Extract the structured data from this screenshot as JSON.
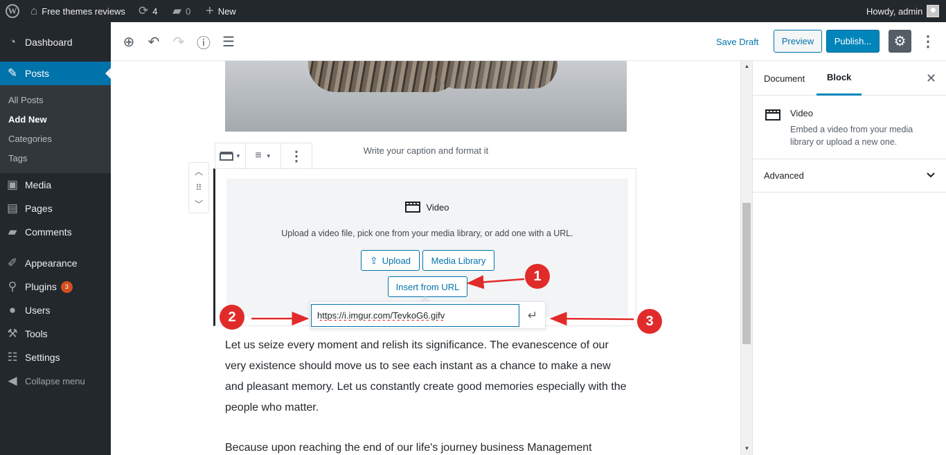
{
  "adminbar": {
    "site_name": "Free themes reviews",
    "updates_count": "4",
    "comments_count": "0",
    "new_label": "New",
    "greeting": "Howdy, admin"
  },
  "sidebar": {
    "dashboard": "Dashboard",
    "posts": "Posts",
    "sub_all_posts": "All Posts",
    "sub_add_new": "Add New",
    "sub_categories": "Categories",
    "sub_tags": "Tags",
    "media": "Media",
    "pages": "Pages",
    "comments": "Comments",
    "appearance": "Appearance",
    "plugins": "Plugins",
    "plugins_badge": "3",
    "users": "Users",
    "tools": "Tools",
    "settings": "Settings",
    "collapse": "Collapse menu"
  },
  "header": {
    "save_draft": "Save Draft",
    "preview": "Preview",
    "publish": "Publish..."
  },
  "editor": {
    "caption": "Write your caption and format it",
    "video_title": "Video",
    "video_instructions": "Upload a video file, pick one from your media library, or add one with a URL.",
    "upload_label": "Upload",
    "media_library_label": "Media Library",
    "insert_url_label": "Insert from URL",
    "url_value": "https://i.imgur.com/TevkoG6.gifv",
    "paragraph_1": "Let us seize every moment and relish its significance. The evanescence of our very existence should move us to see each instant as a chance to make a new and pleasant memory. Let us constantly create good memories especially with the people who matter.",
    "paragraph_2": "Because upon reaching the end of our life's journey business Management"
  },
  "settings_panel": {
    "tab_document": "Document",
    "tab_block": "Block",
    "block_name": "Video",
    "block_description": "Embed a video from your media library or upload a new one.",
    "advanced_label": "Advanced"
  },
  "annotations": {
    "step_1": "1",
    "step_2": "2",
    "step_3": "3",
    "arrow_color": "#e12b2b"
  },
  "colors": {
    "admin_bar_bg": "#23282d",
    "accent": "#0073aa",
    "publish_bg": "#0085ba"
  }
}
